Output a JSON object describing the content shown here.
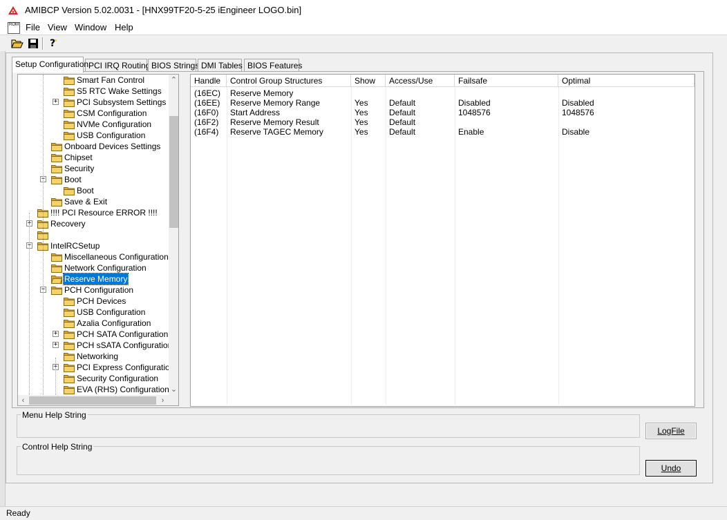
{
  "window": {
    "title": "AMIBCP Version 5.02.0031 - [HNX99TF20-5-25 iEngineer LOGO.bin]"
  },
  "menu": {
    "items": [
      "File",
      "View",
      "Window",
      "Help"
    ],
    "doc_icon_text": "ROM"
  },
  "toolbar": {
    "buttons": [
      {
        "name": "open",
        "icon": "open-folder-icon"
      },
      {
        "name": "save",
        "icon": "floppy-disk-icon"
      },
      {
        "name": "help",
        "icon": "help-question-icon"
      }
    ]
  },
  "tabs": [
    {
      "label": "Setup Configuration",
      "active": true
    },
    {
      "label": "PCI IRQ Routing",
      "active": false
    },
    {
      "label": "BIOS Strings",
      "active": false
    },
    {
      "label": "DMI Tables",
      "active": false
    },
    {
      "label": "BIOS Features",
      "active": false
    }
  ],
  "tree": {
    "items": [
      {
        "label": "Smart Fan Control",
        "level": 2,
        "expander": ""
      },
      {
        "label": "S5 RTC Wake Settings",
        "level": 2,
        "expander": ""
      },
      {
        "label": "PCI Subsystem Settings",
        "level": 2,
        "expander": "+"
      },
      {
        "label": "CSM Configuration",
        "level": 2,
        "expander": ""
      },
      {
        "label": "NVMe Configuration",
        "level": 2,
        "expander": ""
      },
      {
        "label": "USB Configuration",
        "level": 2,
        "expander": ""
      },
      {
        "label": "Onboard Devices Settings",
        "level": 1,
        "expander": ""
      },
      {
        "label": "Chipset",
        "level": 1,
        "expander": ""
      },
      {
        "label": "Security",
        "level": 1,
        "expander": ""
      },
      {
        "label": "Boot",
        "level": 1,
        "expander": "-"
      },
      {
        "label": "Boot",
        "level": 2,
        "expander": ""
      },
      {
        "label": "Save & Exit",
        "level": 1,
        "expander": ""
      },
      {
        "label": "!!!! PCI Resource ERROR !!!!",
        "level": 0,
        "expander": ""
      },
      {
        "label": "Recovery",
        "level": 0,
        "expander": "+"
      },
      {
        "label": "",
        "level": 0,
        "expander": ""
      },
      {
        "label": "IntelRCSetup",
        "level": 0,
        "expander": "-"
      },
      {
        "label": "Miscellaneous Configuration",
        "level": 1,
        "expander": ""
      },
      {
        "label": "Network Configuration",
        "level": 1,
        "expander": ""
      },
      {
        "label": "Reserve Memory",
        "level": 1,
        "expander": "",
        "selected": true
      },
      {
        "label": "PCH Configuration",
        "level": 1,
        "expander": "-"
      },
      {
        "label": "PCH Devices",
        "level": 2,
        "expander": ""
      },
      {
        "label": "USB Configuration",
        "level": 2,
        "expander": ""
      },
      {
        "label": "Azalia Configuration",
        "level": 2,
        "expander": ""
      },
      {
        "label": "PCH SATA Configuration",
        "level": 2,
        "expander": "+"
      },
      {
        "label": "PCH sSATA Configuration",
        "level": 2,
        "expander": "+"
      },
      {
        "label": "Networking",
        "level": 2,
        "expander": ""
      },
      {
        "label": "PCI Express Configuration",
        "level": 2,
        "expander": "+"
      },
      {
        "label": "Security Configuration",
        "level": 2,
        "expander": ""
      },
      {
        "label": "EVA (RHS) Configuration",
        "level": 2,
        "expander": ""
      }
    ]
  },
  "table": {
    "columns": [
      "Handle",
      "Control Group Structures",
      "Show",
      "Access/Use",
      "Failsafe",
      "Optimal"
    ],
    "rows": [
      [
        "(16EC)",
        "Reserve Memory",
        "",
        "",
        "",
        ""
      ],
      [
        "(16EE)",
        "Reserve Memory Range",
        "Yes",
        "Default",
        "Disabled",
        "Disabled"
      ],
      [
        "(16F0)",
        "Start Address",
        "Yes",
        "Default",
        "1048576",
        "1048576"
      ],
      [
        "(16F2)",
        "Reserve Memory Result",
        "Yes",
        "Default",
        "",
        ""
      ],
      [
        "(16F4)",
        "Reserve TAGEC Memory",
        "Yes",
        "Default",
        "Enable",
        "Disable"
      ]
    ]
  },
  "help": {
    "menu_help_title": "Menu Help String",
    "control_help_title": "Control Help String",
    "logfile_button": "LogFile",
    "undo_button": "Undo"
  },
  "status": {
    "text": "Ready"
  },
  "colors": {
    "selection": "#0078d7",
    "folder": "#f3d26b",
    "folder_dark": "#d4a837"
  }
}
